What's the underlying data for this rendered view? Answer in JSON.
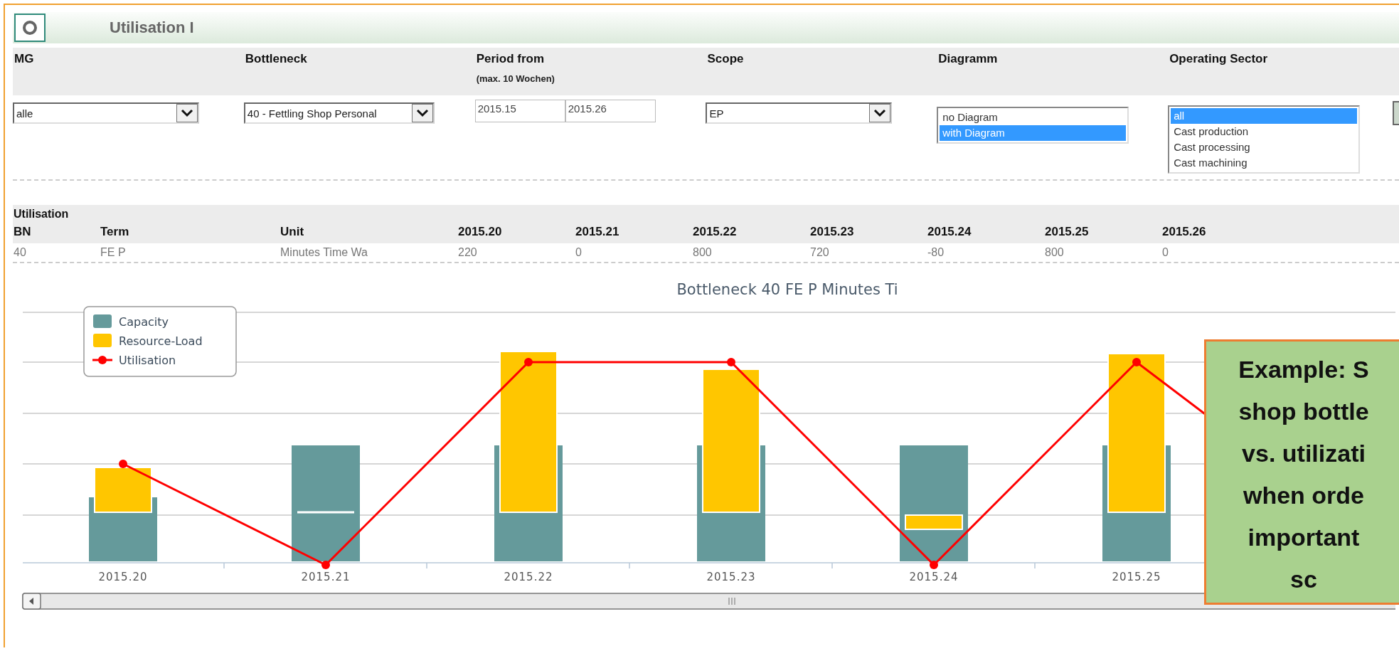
{
  "window": {
    "title": "Utilisation I"
  },
  "filters": [
    {
      "label": "MG",
      "kind": "select",
      "value": "alle"
    },
    {
      "label": "Bottleneck",
      "kind": "select",
      "value": "40 - Fettling Shop Personal"
    },
    {
      "label": "Period from",
      "note": "(max. 10 Wochen)",
      "kind": "range",
      "from": "2015.15",
      "to": "2015.26"
    },
    {
      "label": "Scope",
      "kind": "select",
      "value": "EP"
    },
    {
      "label": "Diagramm",
      "kind": "list",
      "options": [
        {
          "label": "no Diagram",
          "selected": false
        },
        {
          "label": "with Diagram",
          "selected": true
        }
      ]
    },
    {
      "label": "Operating Sector",
      "kind": "list",
      "options": [
        {
          "label": "all",
          "selected": true
        },
        {
          "label": "Cast production",
          "selected": false
        },
        {
          "label": "Cast processing",
          "selected": false
        },
        {
          "label": "Cast machining",
          "selected": false
        }
      ]
    }
  ],
  "utilisation": {
    "title": "Utilisation",
    "columns": [
      "BN",
      "Term",
      "Unit",
      "2015.20",
      "2015.21",
      "2015.22",
      "2015.23",
      "2015.24",
      "2015.25",
      "2015.26"
    ],
    "rows": [
      [
        "40",
        "FE P",
        "Minutes Time Wa",
        "220",
        "0",
        "800",
        "720",
        "-80",
        "800",
        "0"
      ]
    ]
  },
  "chart": {
    "title": "Bottleneck 40 FE P Minutes Ti",
    "legend": [
      {
        "label": "Capacity",
        "kind": "bar",
        "color": "#659a9b"
      },
      {
        "label": "Resource-Load",
        "kind": "bar",
        "color": "#ffc600"
      },
      {
        "label": "Utilisation",
        "kind": "line",
        "color": "#ff0000"
      }
    ],
    "x_labels": [
      "2015.20",
      "2015.21",
      "2015.22",
      "2015.23",
      "2015.24",
      "2015.25"
    ]
  },
  "callout": {
    "lines": [
      "Example: S",
      "shop bottle",
      "vs. utilizati",
      "when orde",
      "important",
      "sc"
    ]
  }
}
